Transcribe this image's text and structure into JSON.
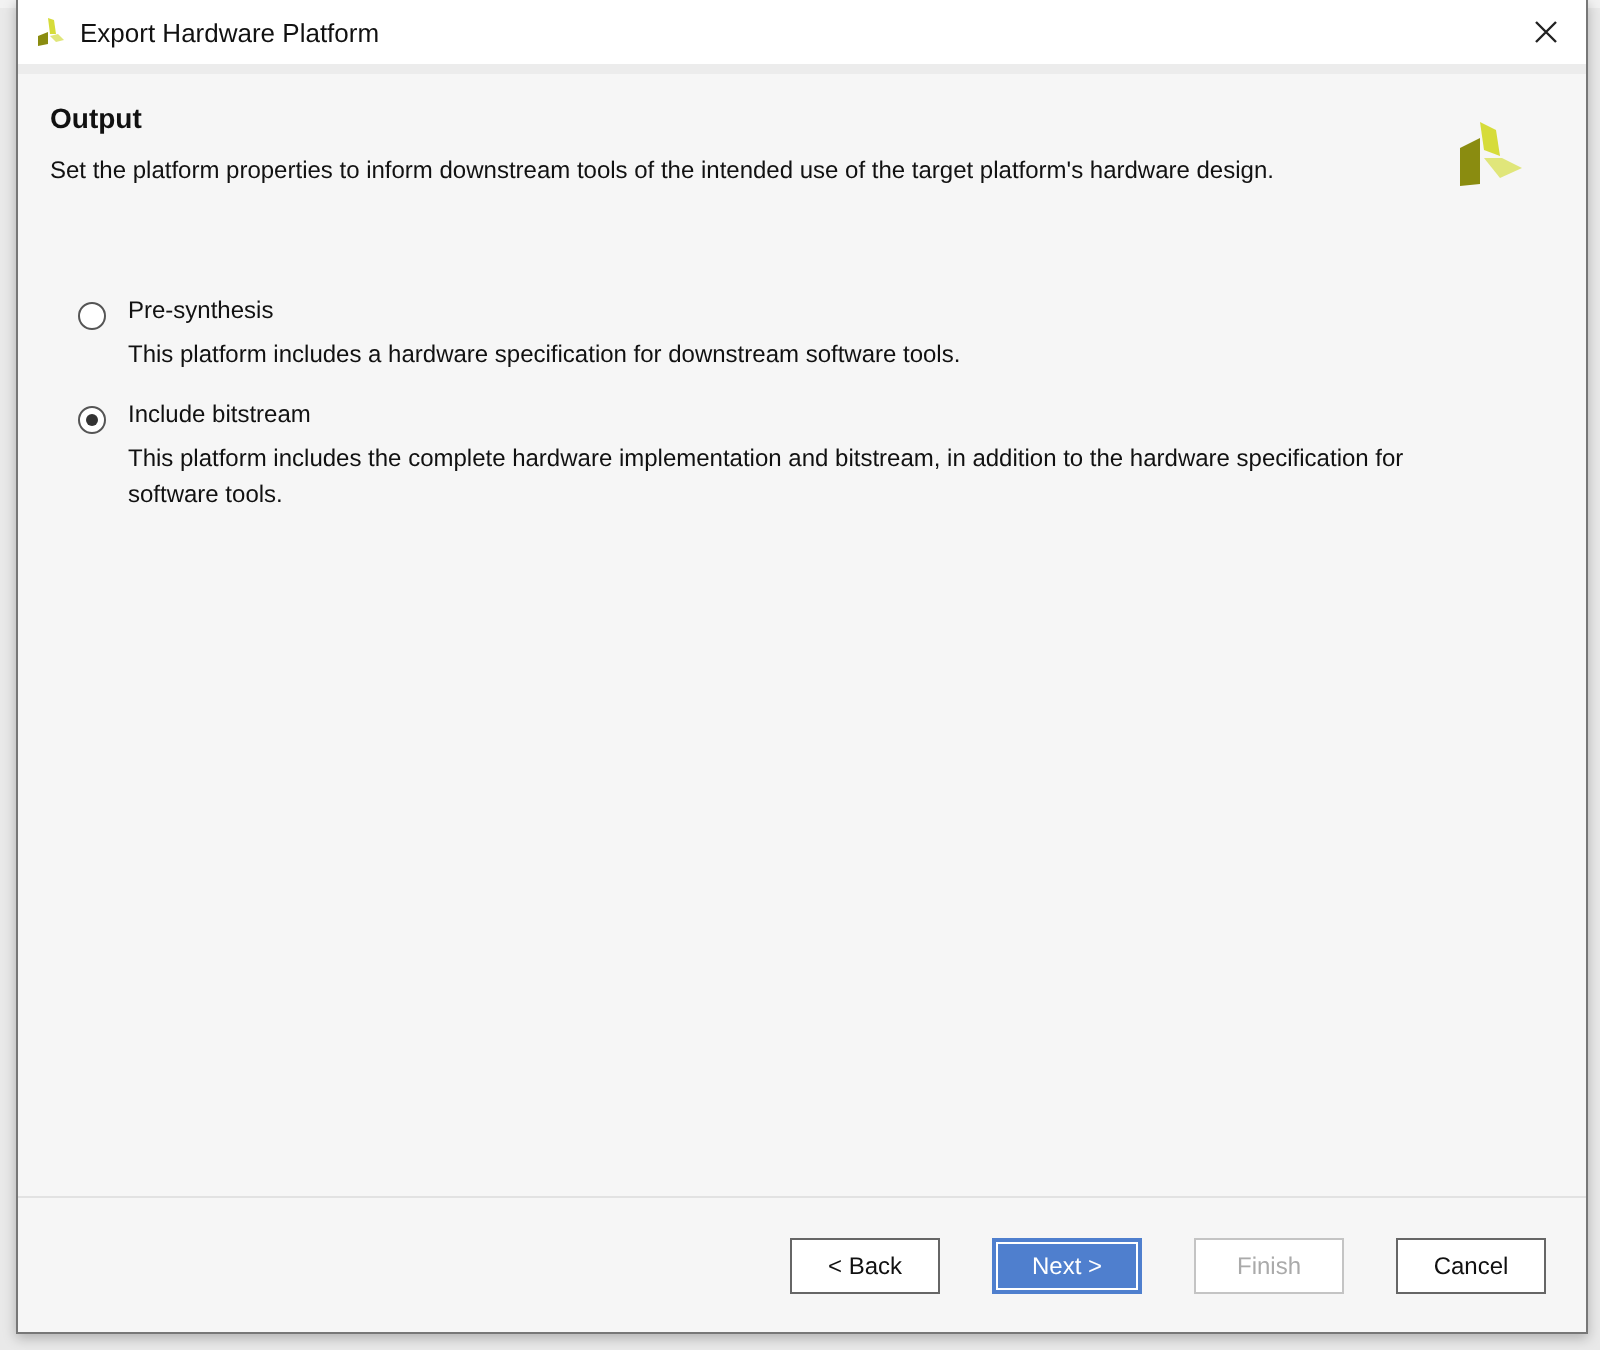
{
  "window": {
    "title": "Export Hardware Platform"
  },
  "header": {
    "title": "Output",
    "description": "Set the platform properties to inform downstream tools of the intended use of the target platform's hardware design."
  },
  "options": [
    {
      "label": "Pre-synthesis",
      "description": "This platform includes a hardware specification for downstream software tools.",
      "selected": false
    },
    {
      "label": "Include bitstream",
      "description": "This platform includes the complete hardware implementation and bitstream, in addition to the hardware specification for software tools.",
      "selected": true
    }
  ],
  "buttons": [
    {
      "label": "< Back",
      "kind": "default",
      "disabled": false
    },
    {
      "label": "Next >",
      "kind": "primary",
      "disabled": false
    },
    {
      "label": "Finish",
      "kind": "default",
      "disabled": true
    },
    {
      "label": "Cancel",
      "kind": "default",
      "disabled": false
    }
  ]
}
